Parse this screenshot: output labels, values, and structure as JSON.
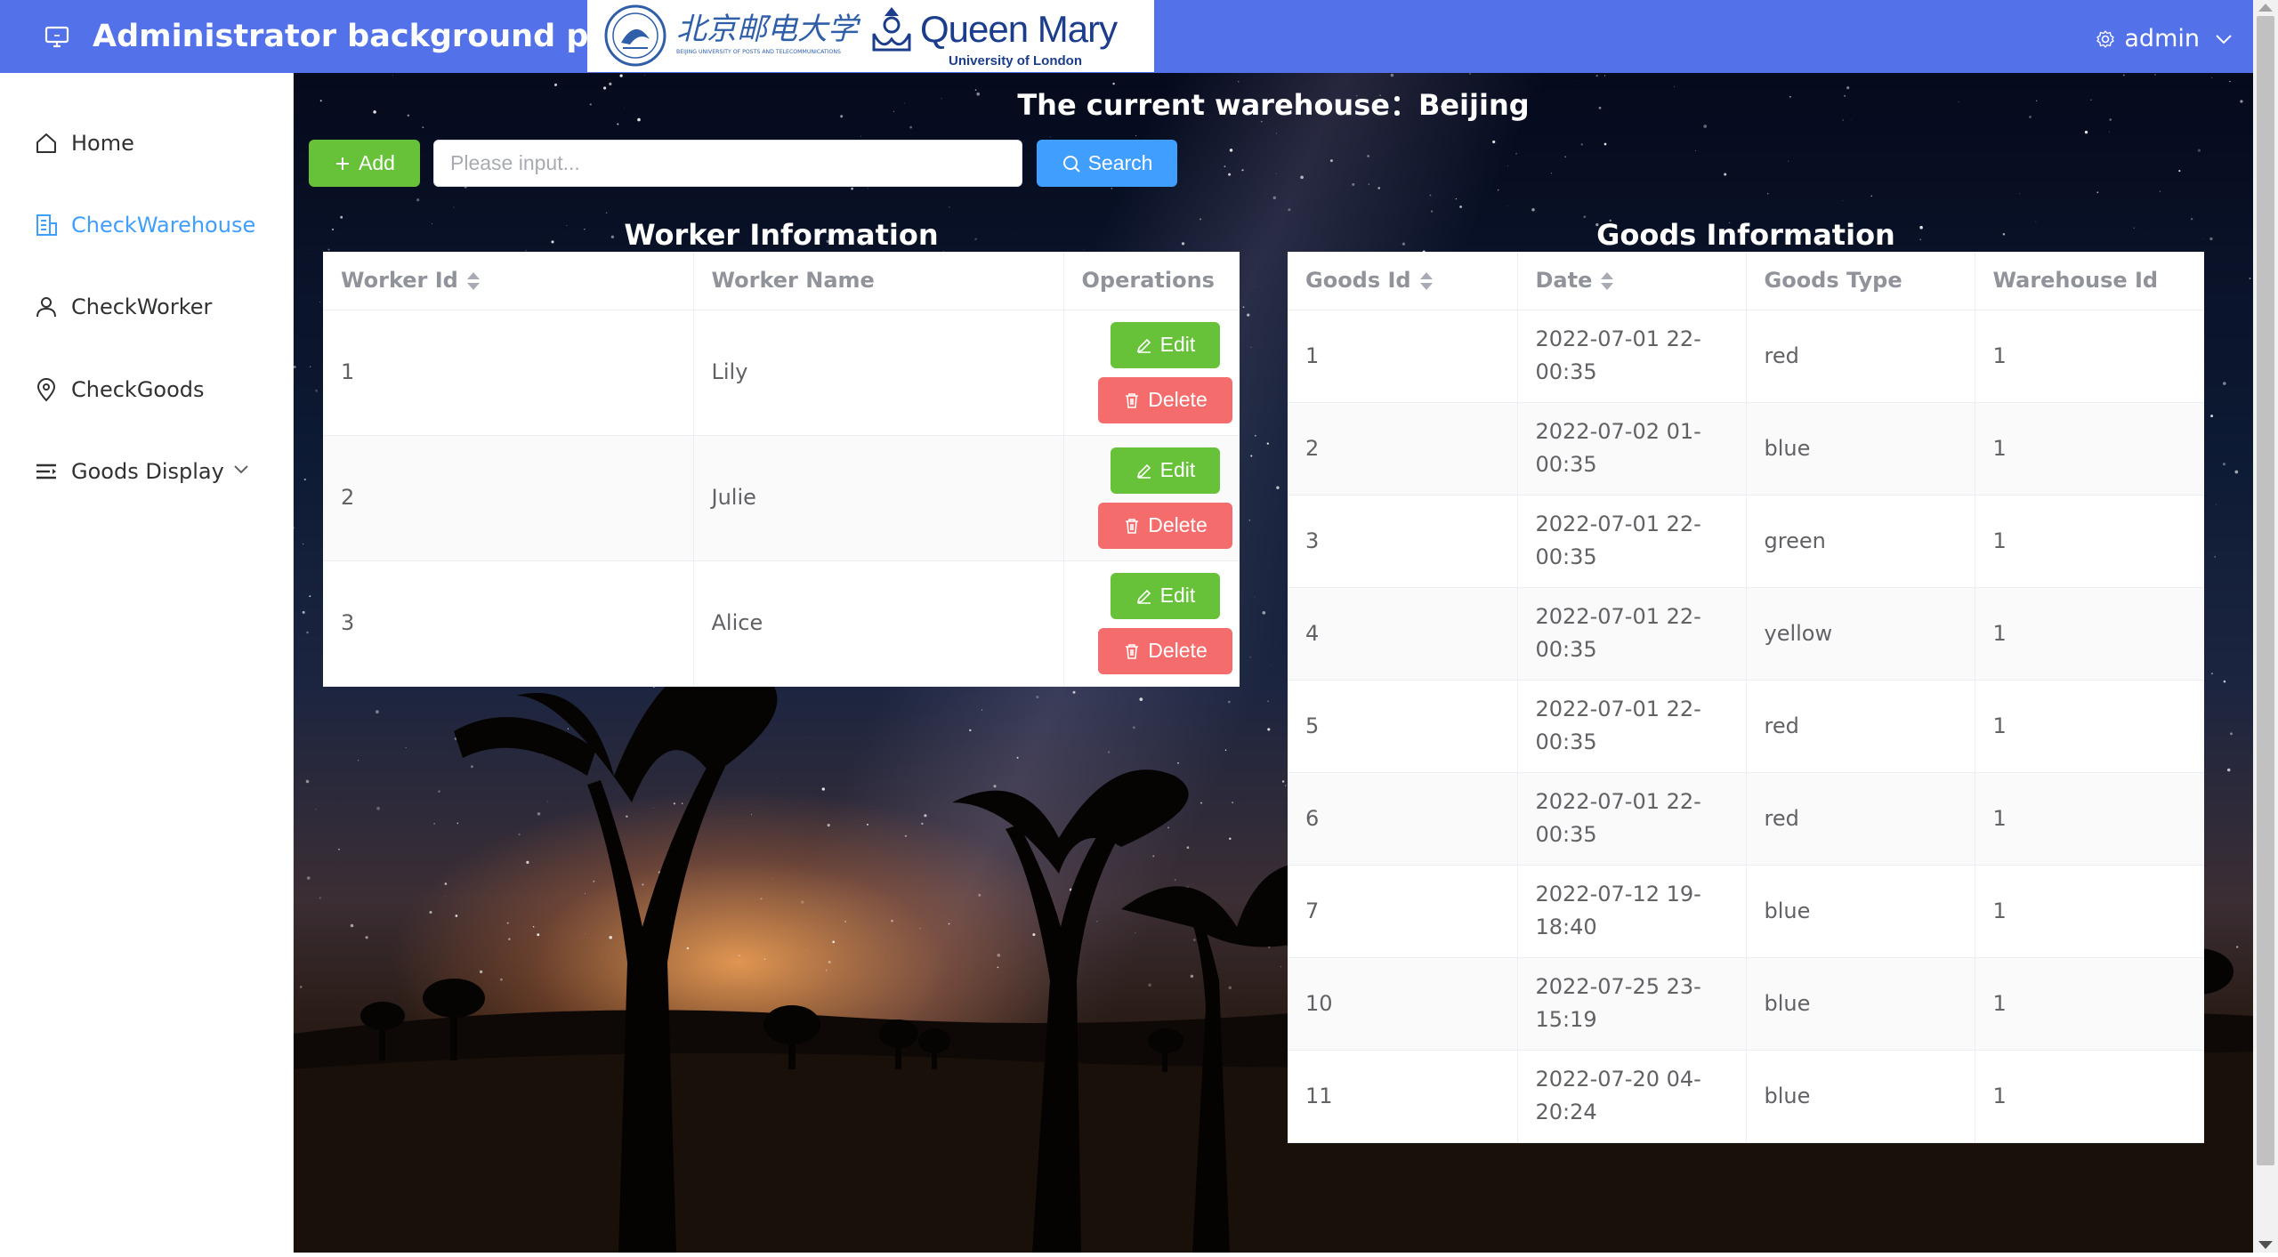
{
  "header": {
    "title": "Administrator background page",
    "user": "admin",
    "logo_bupt_cn": "北京邮电大学",
    "logo_bupt_en": "BEIJING UNIVERSITY OF POSTS AND TELECOMMUNICATIONS",
    "logo_qm_name": "Queen Mary",
    "logo_qm_sub": "University of London"
  },
  "sidebar": {
    "items": [
      {
        "label": "Home",
        "icon": "house-icon"
      },
      {
        "label": "CheckWarehouse",
        "icon": "building-icon",
        "active": true
      },
      {
        "label": "CheckWorker",
        "icon": "user-icon"
      },
      {
        "label": "CheckGoods",
        "icon": "location-pin-icon"
      },
      {
        "label": "Goods Display",
        "icon": "list-icon",
        "expandable": true
      }
    ]
  },
  "main": {
    "warehouse_title": "The current warehouse：Beijing",
    "add_label": "Add",
    "search_placeholder": "Please input...",
    "search_label": "Search"
  },
  "workers": {
    "title": "Worker Information",
    "columns": [
      "Worker Id",
      "Worker Name",
      "Operations"
    ],
    "edit_label": "Edit",
    "delete_label": "Delete",
    "rows": [
      {
        "id": "1",
        "name": "Lily"
      },
      {
        "id": "2",
        "name": "Julie"
      },
      {
        "id": "3",
        "name": "Alice"
      }
    ]
  },
  "goods": {
    "title": "Goods Information",
    "columns": [
      "Goods Id",
      "Date",
      "Goods Type",
      "Warehouse Id"
    ],
    "rows": [
      {
        "id": "1",
        "date": "2022-07-01 22-00:35",
        "type": "red",
        "warehouse": "1"
      },
      {
        "id": "2",
        "date": "2022-07-02 01-00:35",
        "type": "blue",
        "warehouse": "1"
      },
      {
        "id": "3",
        "date": "2022-07-01 22-00:35",
        "type": "green",
        "warehouse": "1"
      },
      {
        "id": "4",
        "date": "2022-07-01 22-00:35",
        "type": "yellow",
        "warehouse": "1"
      },
      {
        "id": "5",
        "date": "2022-07-01 22-00:35",
        "type": "red",
        "warehouse": "1"
      },
      {
        "id": "6",
        "date": "2022-07-01 22-00:35",
        "type": "red",
        "warehouse": "1"
      },
      {
        "id": "7",
        "date": "2022-07-12 19-18:40",
        "type": "blue",
        "warehouse": "1"
      },
      {
        "id": "10",
        "date": "2022-07-25 23-15:19",
        "type": "blue",
        "warehouse": "1"
      },
      {
        "id": "11",
        "date": "2022-07-20 04-20:24",
        "type": "blue",
        "warehouse": "1"
      }
    ]
  },
  "colors": {
    "header": "#5371e8",
    "primary": "#409eff",
    "success": "#67c23a",
    "danger": "#f56c6c"
  }
}
